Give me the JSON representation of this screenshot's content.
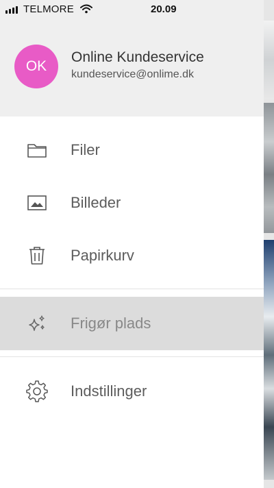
{
  "status_bar": {
    "carrier": "TELMORE",
    "time": "20.09"
  },
  "account": {
    "initials": "OK",
    "avatar_color": "#e85bc6",
    "name": "Online Kundeservice",
    "email": "kundeservice@onlime.dk"
  },
  "menu": {
    "files": {
      "label": "Filer",
      "icon": "folder-icon"
    },
    "photos": {
      "label": "Billeder",
      "icon": "image-icon"
    },
    "trash": {
      "label": "Papirkurv",
      "icon": "trash-icon"
    },
    "free_space": {
      "label": "Frigør plads",
      "icon": "sparkle-icon",
      "active": true
    },
    "settings": {
      "label": "Indstillinger",
      "icon": "gear-icon"
    }
  }
}
